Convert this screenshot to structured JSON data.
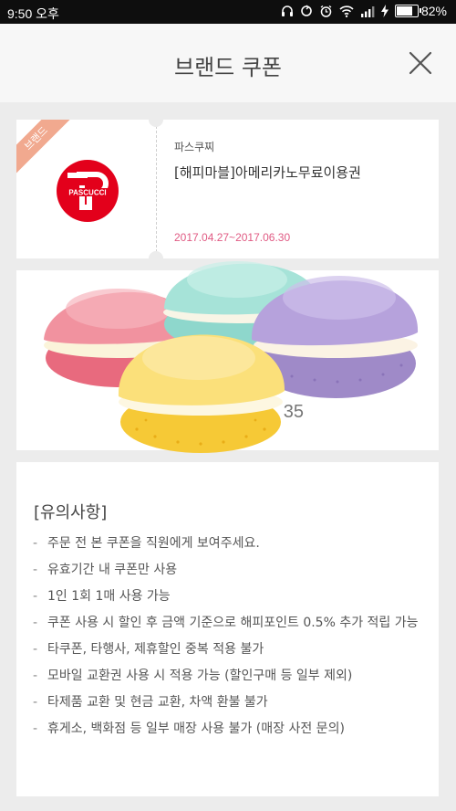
{
  "status_bar": {
    "time": "9:50 오후",
    "battery": "82%",
    "battery_level": 0.82,
    "icons": [
      "headphones-icon",
      "sync-icon",
      "alarm-icon",
      "wifi-icon",
      "signal-icon",
      "charging-icon",
      "battery-icon"
    ]
  },
  "header": {
    "title": "브랜드 쿠폰",
    "close_icon": "close-icon"
  },
  "coupon": {
    "badge": "브랜드",
    "brand": "파스쿠찌",
    "name": "[해피마블]아메리카노무료이용권",
    "period": "2017.04.27~2017.06.30",
    "logo_text": "PASCUCCI",
    "badge_color": "#f1a98f",
    "period_color": "#e05a83",
    "logo_color": "#e3001b"
  },
  "barcode": {
    "number": "35"
  },
  "notice": {
    "title": "[유의사항]",
    "items": [
      "주문 전 본 쿠폰을 직원에게 보여주세요.",
      "유효기간 내 쿠폰만 사용",
      "1인 1회 1매 사용 가능",
      "쿠폰 사용 시 할인 후 금액 기준으로 해피포인트 0.5% 추가 적립 가능",
      "타쿠폰, 타행사, 제휴할인 중복 적용 불가",
      "모바일 교환권 사용 시 적용 가능 (할인구매 등 일부 제외)",
      "타제품 교환 및 현금 교환, 차액 환불 불가",
      "휴게소, 백화점 등 일부 매장 사용 불가 (매장 사전 문의)"
    ]
  }
}
